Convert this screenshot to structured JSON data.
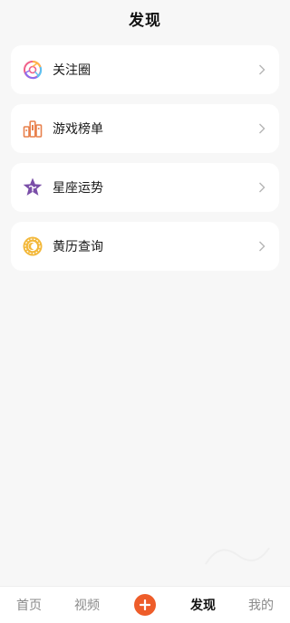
{
  "header": {
    "title": "发现"
  },
  "items": [
    {
      "label": "关注圈",
      "icon": "follow-circle-icon"
    },
    {
      "label": "游戏榜单",
      "icon": "game-ranking-icon"
    },
    {
      "label": "星座运势",
      "icon": "star-horoscope-icon"
    },
    {
      "label": "黄历查询",
      "icon": "almanac-coin-icon"
    }
  ],
  "tabbar": {
    "home": "首页",
    "video": "视频",
    "add_icon": "plus-icon",
    "discover": "发现",
    "mine": "我的"
  },
  "colors": {
    "accent": "#ee5d2a",
    "background": "#f7f7f7",
    "card": "#ffffff"
  }
}
